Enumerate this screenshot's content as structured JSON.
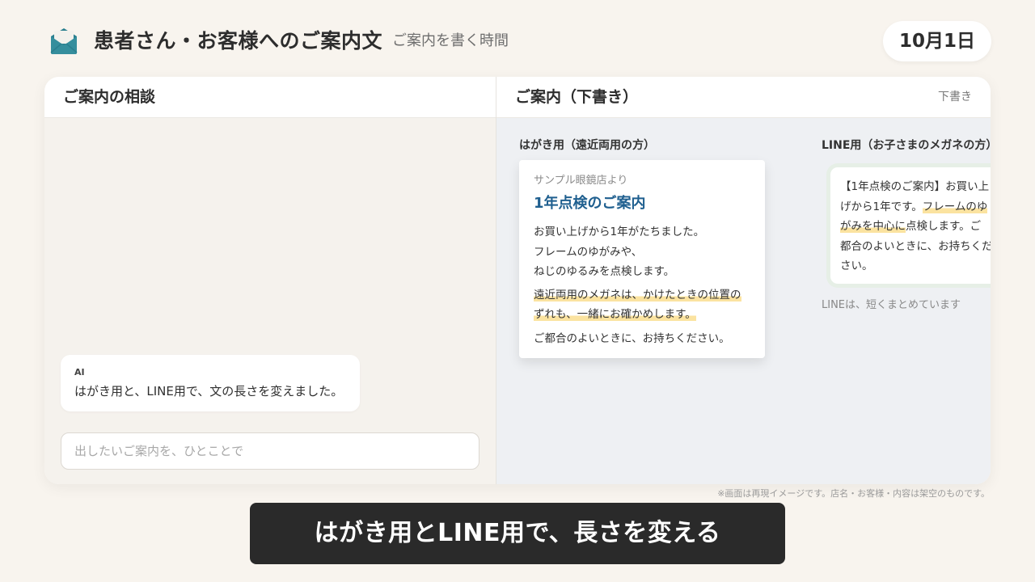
{
  "app": {
    "icon": "envelope-icon",
    "title": "患者さん・お客様へのご案内文",
    "subtitle": "ご案内を書く時間",
    "date": "10月1日"
  },
  "left_panel": {
    "title": "ご案内の相談",
    "ai_message": {
      "sender": "AI",
      "text": "はがき用と、LINE用で、文の長さを変えました。"
    },
    "input_placeholder": "出したいご案内を、ひとことで"
  },
  "right_panel": {
    "title": "ご案内（下書き）",
    "badge": "下書き",
    "postcard": {
      "label": "はがき用（遠近両用の方）",
      "sender": "サンプル眼鏡店より",
      "title": "1年点検のご案内",
      "lines": [
        "お買い上げから1年がたちました。",
        "フレームのゆがみや、",
        "ねじのゆるみを点検します。"
      ],
      "highlight_lines": [
        "遠近両用のメガネは、かけたときの位置の",
        "ずれも、一緒にお確かめします。"
      ],
      "closing": "ご都合のよいときに、お持ちください。"
    },
    "line_message": {
      "label": "LINE用（お子さまのメガネの方）",
      "lines": [
        {
          "plain": "【1年点検のご案内】お買い上",
          "highlight": ""
        },
        {
          "plain": "げから1年です。",
          "highlight": "フレームのゆ"
        },
        {
          "plain": "",
          "highlight": "がみを中心に",
          "after": "点検します。ご"
        },
        {
          "plain": "都合のよいときに、お持ちくだ",
          "highlight": ""
        },
        {
          "plain": "さい。",
          "highlight": ""
        }
      ],
      "note": "LINEは、短くまとめています"
    }
  },
  "disclaimer": "※画面は再現イメージです。店名・お客様・内容は架空のものです。",
  "caption": "はがき用とLINE用で、長さを変える",
  "colors": {
    "accent": "#1f5f8f",
    "highlight": "#fbe3a0",
    "icon": "#2a7f8f",
    "caption_bg": "#2a2a2a"
  }
}
